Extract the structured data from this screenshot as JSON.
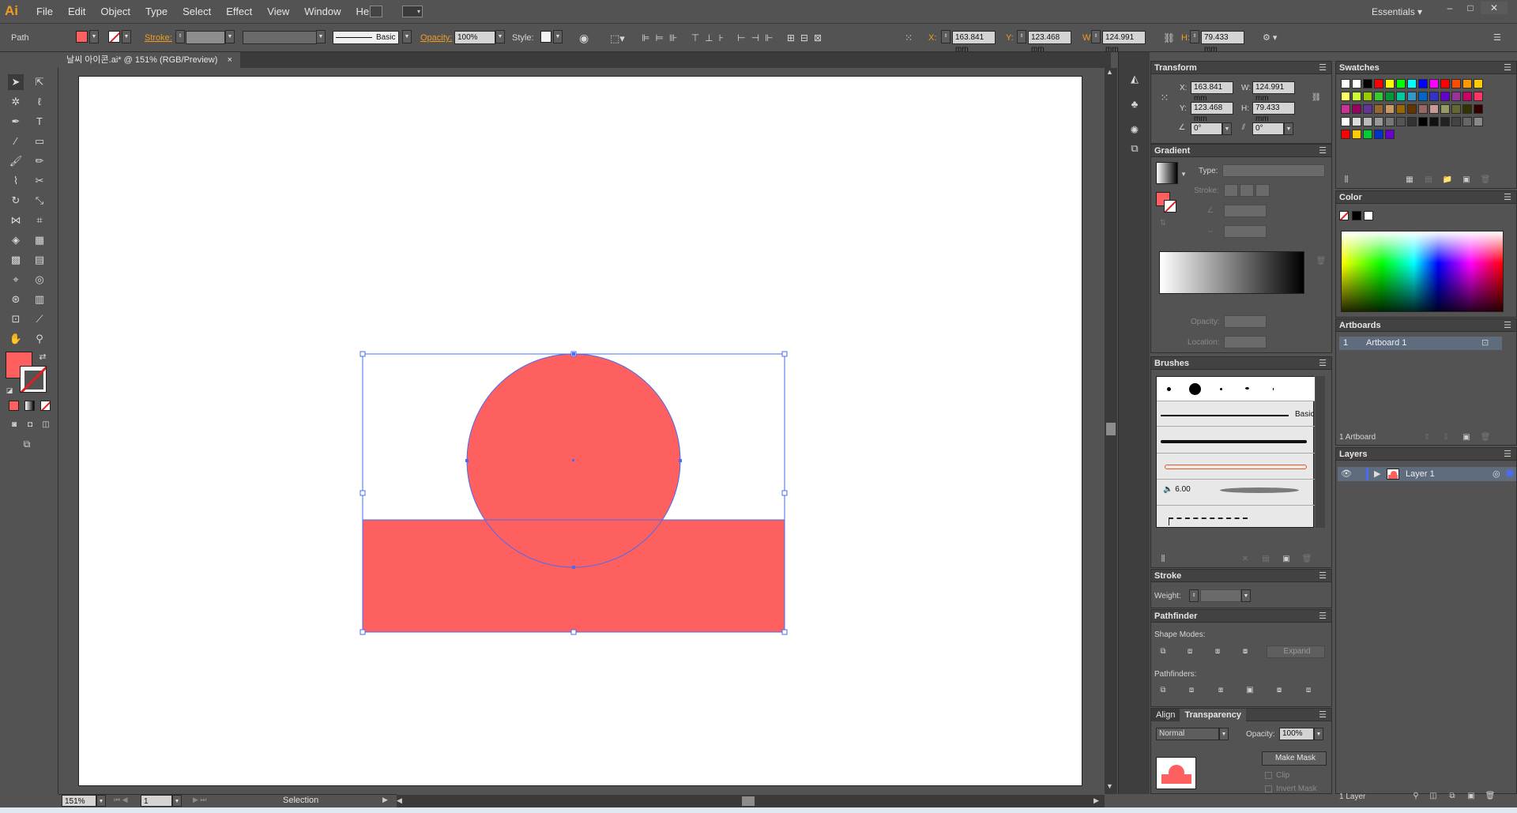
{
  "app": {
    "logo": "Ai"
  },
  "menu": [
    "File",
    "Edit",
    "Object",
    "Type",
    "Select",
    "Effect",
    "View",
    "Window",
    "Help"
  ],
  "workspace": "Essentials",
  "window_buttons": [
    "–",
    "□",
    "✕"
  ],
  "control": {
    "selection_type": "Path",
    "stroke_label": "Stroke:",
    "brush_label": "Basic",
    "opacity_label": "Opacity:",
    "opacity_value": "100%",
    "style_label": "Style:",
    "x_label": "X:",
    "x_value": "163.841 mm",
    "y_label": "Y:",
    "y_value": "123.468 mm",
    "w_label": "W:",
    "w_value": "124.991 mm",
    "h_label": "H:",
    "h_value": "79.433 mm"
  },
  "document_tab": {
    "title": "날씨 아이콘.ai* @ 151% (RGB/Preview)",
    "close": "×"
  },
  "colors": {
    "fill": "#fe5f5f",
    "selection": "#4a6cf5",
    "orange": "#f09b22"
  },
  "status": {
    "zoom": "151%",
    "artboard": "1",
    "tool": "Selection"
  },
  "transform": {
    "title": "Transform",
    "x_label": "X:",
    "x": "163.841 mm",
    "y_label": "Y:",
    "y": "123.468 mm",
    "w_label": "W:",
    "w": "124.991 mm",
    "h_label": "H:",
    "h": "79.433 mm",
    "angle": "0°",
    "shear": "0°"
  },
  "gradient": {
    "title": "Gradient",
    "type_label": "Type:",
    "stroke_label": "Stroke:",
    "opacity_label": "Opacity:",
    "location_label": "Location:"
  },
  "brushes": {
    "title": "Brushes",
    "basic_label": "Basic",
    "size_label": "6.00"
  },
  "stroke": {
    "title": "Stroke",
    "weight_label": "Weight:"
  },
  "pathfinder": {
    "title": "Pathfinder",
    "shape_modes": "Shape Modes:",
    "expand": "Expand",
    "pathfinders": "Pathfinders:"
  },
  "transparency": {
    "tab_align": "Align",
    "tab_transparency": "Transparency",
    "mode": "Normal",
    "opacity_label": "Opacity:",
    "opacity": "100%",
    "make_mask": "Make Mask",
    "clip": "Clip",
    "invert_mask": "Invert Mask"
  },
  "swatches": {
    "title": "Swatches"
  },
  "color": {
    "title": "Color"
  },
  "artboards": {
    "title": "Artboards",
    "row_index": "1",
    "row_name": "Artboard 1",
    "footer": "1 Artboard"
  },
  "layers": {
    "title": "Layers",
    "layer_name": "Layer 1",
    "footer": "1 Layer"
  }
}
